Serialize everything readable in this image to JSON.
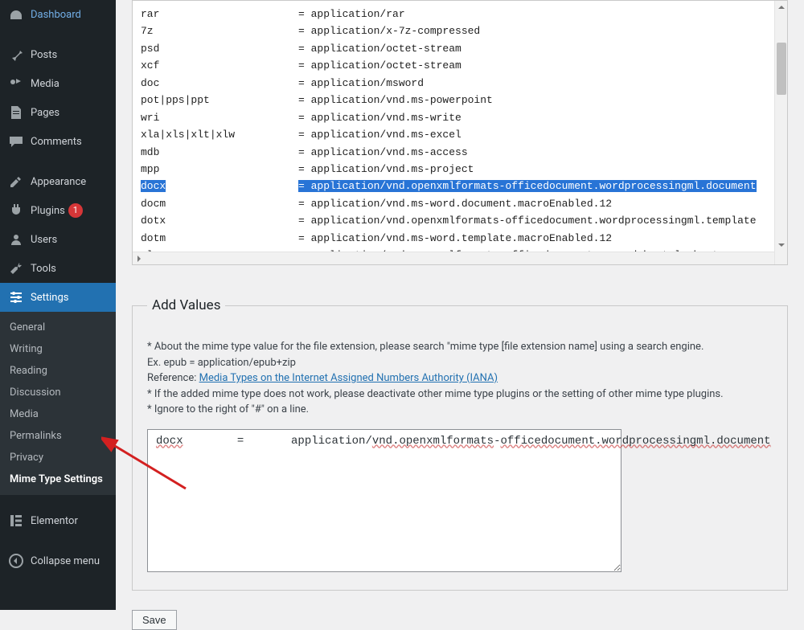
{
  "sidebar": {
    "items": [
      {
        "label": "Dashboard",
        "icon": "dashboard"
      },
      {
        "label": "Posts",
        "icon": "pin"
      },
      {
        "label": "Media",
        "icon": "media"
      },
      {
        "label": "Pages",
        "icon": "pages"
      },
      {
        "label": "Comments",
        "icon": "comments"
      },
      {
        "label": "Appearance",
        "icon": "appearance"
      },
      {
        "label": "Plugins",
        "icon": "plugins",
        "badge": "1"
      },
      {
        "label": "Users",
        "icon": "users"
      },
      {
        "label": "Tools",
        "icon": "tools"
      },
      {
        "label": "Settings",
        "icon": "settings",
        "active": true
      },
      {
        "label": "Elementor",
        "icon": "elementor"
      },
      {
        "label": "Collapse menu",
        "icon": "collapse"
      }
    ],
    "submenu": [
      "General",
      "Writing",
      "Reading",
      "Discussion",
      "Media",
      "Permalinks",
      "Privacy",
      "Mime Type Settings"
    ]
  },
  "mimes": [
    {
      "ext": "rar",
      "val": "application/rar"
    },
    {
      "ext": "7z",
      "val": "application/x-7z-compressed"
    },
    {
      "ext": "psd",
      "val": "application/octet-stream"
    },
    {
      "ext": "xcf",
      "val": "application/octet-stream"
    },
    {
      "ext": "doc",
      "val": "application/msword"
    },
    {
      "ext": "pot|pps|ppt",
      "val": "application/vnd.ms-powerpoint"
    },
    {
      "ext": "wri",
      "val": "application/vnd.ms-write"
    },
    {
      "ext": "xla|xls|xlt|xlw",
      "val": "application/vnd.ms-excel"
    },
    {
      "ext": "mdb",
      "val": "application/vnd.ms-access"
    },
    {
      "ext": "mpp",
      "val": "application/vnd.ms-project"
    },
    {
      "ext": "docx",
      "val": "application/vnd.openxmlformats-officedocument.wordprocessingml.document",
      "hl": true
    },
    {
      "ext": "docm",
      "val": "application/vnd.ms-word.document.macroEnabled.12"
    },
    {
      "ext": "dotx",
      "val": "application/vnd.openxmlformats-officedocument.wordprocessingml.template"
    },
    {
      "ext": "dotm",
      "val": "application/vnd.ms-word.template.macroEnabled.12"
    },
    {
      "ext": "xlsx",
      "val": "application/vnd.openxmlformats-officedocument.spreadsheetml.sheet"
    }
  ],
  "add": {
    "legend": "Add Values",
    "help_line1": "* About the mime type value for the file extension, please search \"mime type [file extension name] using a search engine.",
    "help_line2": "Ex. epub = application/epub+zip",
    "help_ref_prefix": "Reference: ",
    "help_ref_link": "Media Types on the Internet Assigned Numbers Authority (IANA)",
    "help_line4": "* If the added mime type does not work, please deactivate other mime type plugins or the setting of other mime type plugins.",
    "help_line5": "* Ignore to the right of \"#\" on a line.",
    "textarea_value": "docx        =       application/vnd.openxmlformats-officedocument.wordprocessingml.document",
    "save_label": "Save"
  }
}
